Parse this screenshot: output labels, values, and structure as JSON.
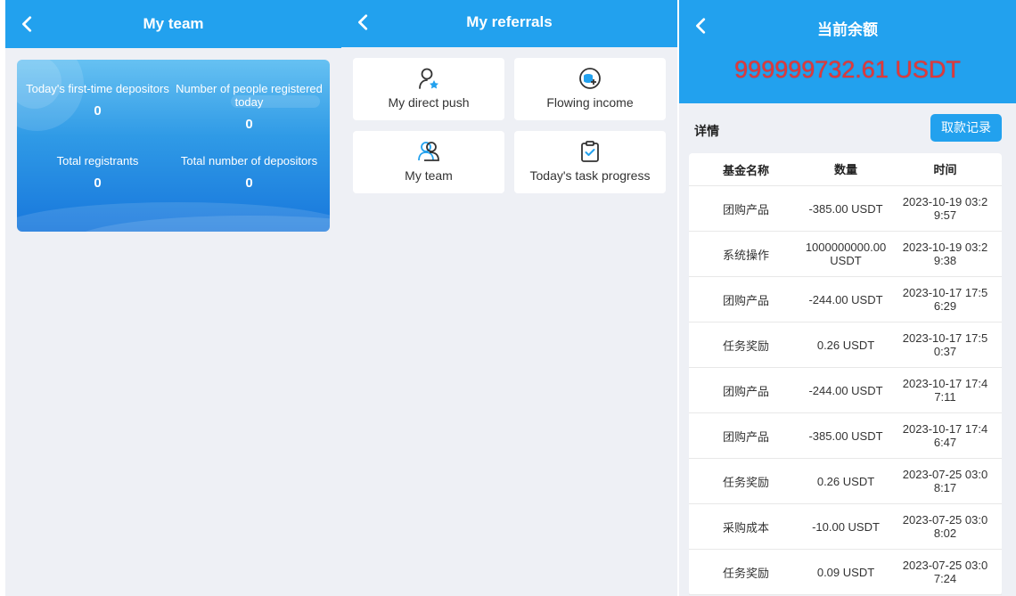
{
  "panels": {
    "team": {
      "title": "My team",
      "stats": [
        {
          "label": "Today's first-time depositors",
          "value": "0"
        },
        {
          "label": "Number of people registered today",
          "value": "0"
        },
        {
          "label": "Total registrants",
          "value": "0"
        },
        {
          "label": "Total number of depositors",
          "value": "0"
        }
      ]
    },
    "referrals": {
      "title": "My referrals",
      "tiles": [
        {
          "label": "My direct push",
          "icon": "user-star-icon"
        },
        {
          "label": "Flowing income",
          "icon": "coins-icon"
        },
        {
          "label": "My team",
          "icon": "group-icon"
        },
        {
          "label": "Today's task progress",
          "icon": "clipboard-check-icon"
        }
      ]
    },
    "balance": {
      "title": "当前余额",
      "amount": "999999732.61 USDT",
      "details_label": "详情",
      "withdraw_button": "取款记录",
      "table": {
        "headers": [
          "基金名称",
          "数量",
          "时间"
        ],
        "rows": [
          {
            "name": "团购产品",
            "amount": "-385.00 USDT",
            "time": "2023-10-19 03:29:57"
          },
          {
            "name": "系统操作",
            "amount": "1000000000.00 USDT",
            "time": "2023-10-19 03:29:38"
          },
          {
            "name": "团购产品",
            "amount": "-244.00 USDT",
            "time": "2023-10-17 17:56:29"
          },
          {
            "name": "任务奖励",
            "amount": "0.26 USDT",
            "time": "2023-10-17 17:50:37"
          },
          {
            "name": "团购产品",
            "amount": "-244.00 USDT",
            "time": "2023-10-17 17:47:11"
          },
          {
            "name": "团购产品",
            "amount": "-385.00 USDT",
            "time": "2023-10-17 17:46:47"
          },
          {
            "name": "任务奖励",
            "amount": "0.26 USDT",
            "time": "2023-07-25 03:08:17"
          },
          {
            "name": "采购成本",
            "amount": "-10.00 USDT",
            "time": "2023-07-25 03:08:02"
          },
          {
            "name": "任务奖励",
            "amount": "0.09 USDT",
            "time": "2023-07-25 03:07:24"
          }
        ]
      }
    }
  },
  "colors": {
    "accent": "#22a1ee",
    "balance": "#e0393a",
    "background": "#eef0f5"
  }
}
